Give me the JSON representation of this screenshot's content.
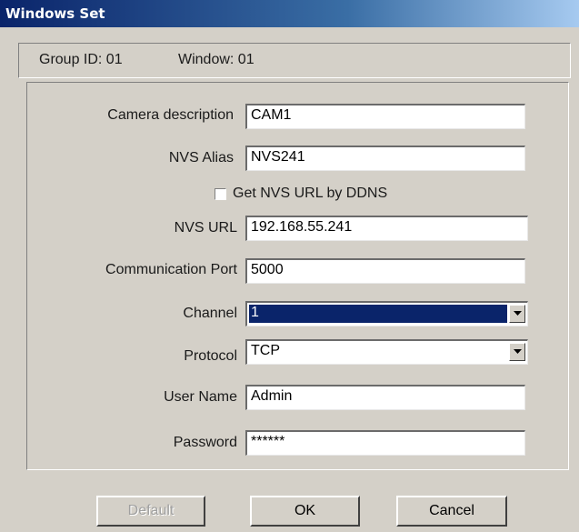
{
  "window": {
    "title": "Windows Set"
  },
  "info": {
    "group": "Group ID: 01",
    "window": "Window: 01"
  },
  "form": {
    "camera_description": {
      "label": "Camera description",
      "value": "CAM1"
    },
    "nvs_alias": {
      "label": "NVS Alias",
      "value": "NVS241"
    },
    "ddns": {
      "label": "Get NVS URL by DDNS",
      "checked": false
    },
    "nvs_url": {
      "label": "NVS URL",
      "value": "192.168.55.241"
    },
    "comm_port": {
      "label": "Communication Port",
      "value": "5000"
    },
    "channel": {
      "label": "Channel",
      "value": "1"
    },
    "protocol": {
      "label": "Protocol",
      "value": "TCP"
    },
    "user_name": {
      "label": "User Name",
      "value": "Admin"
    },
    "password": {
      "label": "Password",
      "value": "******"
    }
  },
  "buttons": {
    "default": {
      "label": "Default",
      "enabled": false
    },
    "ok": {
      "label": "OK",
      "enabled": true
    },
    "cancel": {
      "label": "Cancel",
      "enabled": true
    }
  },
  "colors": {
    "dialog_bg": "#d4d0c8",
    "title_bar": "#0a246a",
    "selection": "#0a246a"
  }
}
